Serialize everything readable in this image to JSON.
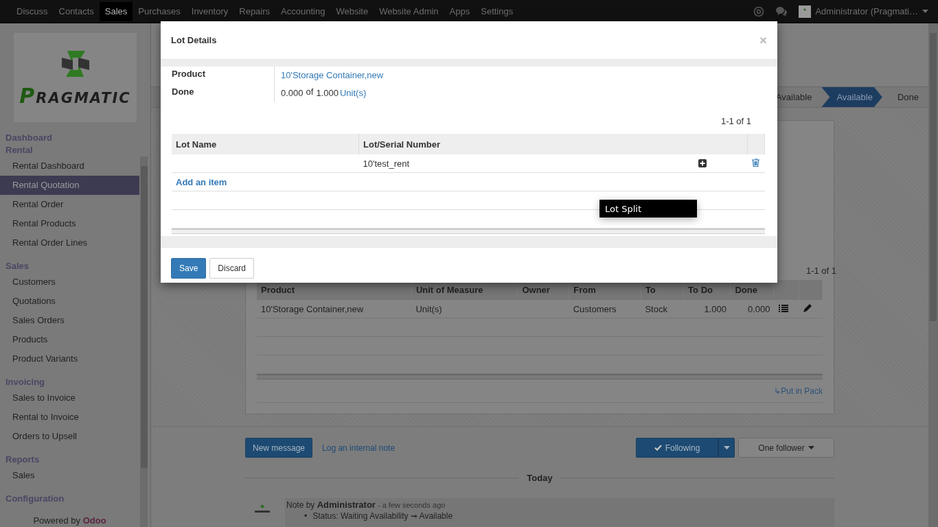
{
  "top_menu": {
    "items": [
      {
        "label": "Discuss",
        "selected": false
      },
      {
        "label": "Contacts",
        "selected": false
      },
      {
        "label": "Sales",
        "selected": true
      },
      {
        "label": "Purchases",
        "selected": false
      },
      {
        "label": "Inventory",
        "selected": false
      },
      {
        "label": "Repairs",
        "selected": false
      },
      {
        "label": "Accounting",
        "selected": false
      },
      {
        "label": "Website",
        "selected": false
      },
      {
        "label": "Website Admin",
        "selected": false
      },
      {
        "label": "Apps",
        "selected": false
      },
      {
        "label": "Settings",
        "selected": false
      }
    ],
    "user": "Administrator (Pragmati…"
  },
  "sidebar": {
    "logo": "PRAGMATIC",
    "sections": [
      {
        "title": "Dashboard"
      },
      {
        "title": "Rental",
        "items": [
          {
            "label": "Rental Dashboard",
            "selected": false
          },
          {
            "label": "Rental Quotation",
            "selected": true
          },
          {
            "label": "Rental Order",
            "selected": false
          },
          {
            "label": "Rental Products",
            "selected": false
          },
          {
            "label": "Rental Order Lines",
            "selected": false
          }
        ]
      },
      {
        "title": "Sales",
        "items": [
          {
            "label": "Customers",
            "selected": false
          },
          {
            "label": "Quotations",
            "selected": false
          },
          {
            "label": "Sales Orders",
            "selected": false
          },
          {
            "label": "Products",
            "selected": false
          },
          {
            "label": "Product Variants",
            "selected": false
          }
        ]
      },
      {
        "title": "Invoicing",
        "items": [
          {
            "label": "Sales to Invoice",
            "selected": false
          },
          {
            "label": "Rental to Invoice",
            "selected": false
          },
          {
            "label": "Orders to Upsell",
            "selected": false
          }
        ]
      },
      {
        "title": "Reports",
        "items": [
          {
            "label": "Sales",
            "selected": false
          }
        ]
      },
      {
        "title": "Configuration"
      }
    ],
    "footer": "Powered by **Odoo**"
  },
  "status_bar": {
    "stages": [
      {
        "label": "Available",
        "selected": false
      },
      {
        "label": "Available",
        "selected": true
      },
      {
        "label": "Done",
        "selected": false
      }
    ]
  },
  "sheet": {
    "pager": "1-1 of 1",
    "table": {
      "columns": [
        "Product",
        "Unit of Measure",
        "Owner",
        "From",
        "To",
        "To Do",
        "Done"
      ],
      "rows": [
        [
          "10'Storage Container,new",
          "Unit(s)",
          "",
          "Customers",
          "Stock",
          "1.000",
          "0.000"
        ]
      ]
    },
    "put_in_pack": "↳Put in Pack"
  },
  "chatter": {
    "new_message": "New message",
    "log_note": "Log an internal note",
    "following": "Following",
    "followers": "One follower",
    "date_separator": "Today",
    "message": {
      "author_line": "Note by **Administrator**",
      "time": "- a few seconds ago",
      "changes": [
        {
          "bullet": "•",
          "text": "Status: Waiting Availability ➞ Available"
        }
      ]
    }
  },
  "dialog": {
    "title": "Lot Details",
    "close": "×",
    "fields": [
      {
        "label": "Product",
        "kind": "link",
        "value": "10'Storage Container,new"
      },
      {
        "label": "Done",
        "kind": "quantity",
        "done": "0.000",
        "of": "of",
        "total": "1.000",
        "unit": "Unit(s)"
      }
    ],
    "pager": "1-1 of 1",
    "table": {
      "columns": [
        "Lot Name",
        "Lot/Serial Number"
      ],
      "rows": [
        {
          "serial": "10'test_rent"
        }
      ]
    },
    "add_item": "Add an item",
    "buttons": [
      {
        "label": "Save",
        "kind": "primary"
      },
      {
        "label": "Discard",
        "kind": "secondary"
      }
    ]
  },
  "tooltip": {
    "text": "Lot Split"
  }
}
